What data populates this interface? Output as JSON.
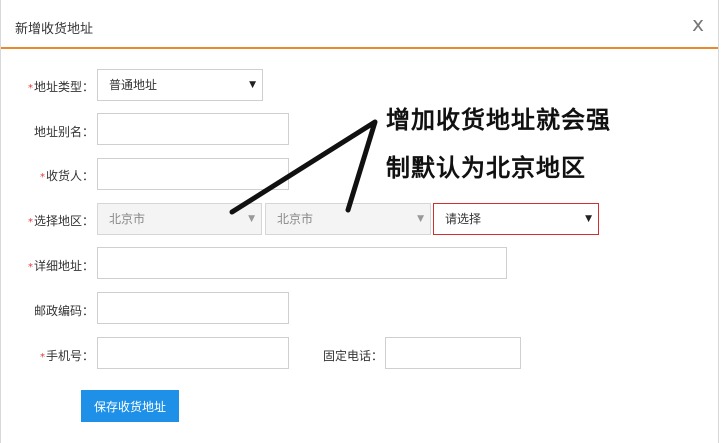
{
  "dialog": {
    "title": "新增收货地址",
    "close_label": "x"
  },
  "form": {
    "required_mark": "*",
    "address_type": {
      "label": "地址类型：",
      "value": "普通地址"
    },
    "alias": {
      "label": "地址别名：",
      "value": ""
    },
    "recipient": {
      "label": "收货人：",
      "value": ""
    },
    "region": {
      "label": "选择地区：",
      "province": "北京市",
      "city": "北京市",
      "district": "请选择"
    },
    "detail": {
      "label": "详细地址：",
      "value": ""
    },
    "postcode": {
      "label": "邮政编码：",
      "value": ""
    },
    "mobile": {
      "label": "手机号：",
      "value": ""
    },
    "phone": {
      "label": "固定电话：",
      "value": ""
    },
    "submit_label": "保存收货地址"
  },
  "annotation": {
    "line1": "增加收货地址就会强",
    "line2": "制默认为北京地区"
  },
  "colors": {
    "accent": "#e8892d",
    "button": "#1e90e8",
    "required": "#e4393c",
    "highlight_border": "#d32f2f"
  }
}
